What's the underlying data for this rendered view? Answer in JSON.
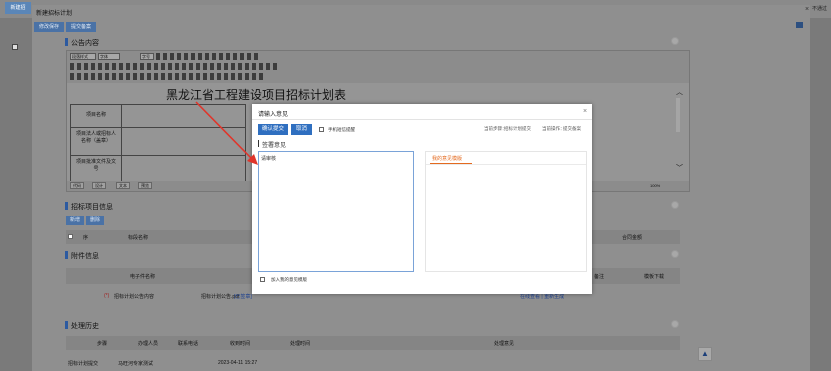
{
  "app": {
    "tab": "新建招",
    "right_text": "不通过"
  },
  "panel": {
    "title": "新建招标计划",
    "close": "×"
  },
  "toolbar": {
    "save": "修改保存",
    "submit": "提交备案"
  },
  "notice": {
    "title": "公告内容",
    "toolbar_style": "段落样式",
    "toolbar_font": "字体",
    "toolbar_size": "字号",
    "doc_title": "黑龙江省工程建设项目招标计划表",
    "rows": [
      "项目名称",
      "项目法人或招标人名称（盖章）",
      "项目批准文件及文号"
    ],
    "tabs": [
      "代码",
      "设计",
      "文本",
      "预览"
    ],
    "zoom": "100%"
  },
  "bid_info": {
    "title": "招标项目信息",
    "add": "新增",
    "delete": "删除",
    "headers": [
      "序",
      "标段名称",
      "合同金额"
    ]
  },
  "attachments": {
    "title": "附件信息",
    "headers": [
      "电子件名称",
      "备注",
      "模板下载"
    ],
    "row": {
      "required": "(*)",
      "name": "招标计划公告内容",
      "file": "招标计划公告.pdf",
      "file_link": "[已签章]",
      "actions": "在线查看 | 重新生成"
    }
  },
  "history": {
    "title": "处理历史",
    "headers": [
      "步骤",
      "办理人员",
      "联系电话",
      "收到时间",
      "处理时间",
      "处理意见"
    ],
    "row": {
      "step": "招标计划提交",
      "person": "马旺河专家测试",
      "received": "2023-04-11 15:27"
    }
  },
  "dialog": {
    "title": "请输入意见",
    "confirm": "确认提交",
    "cancel": "取消",
    "sms": "手机短信提醒",
    "current_step_label": "当前步骤：",
    "current_step": "招标计划提交",
    "current_op_label": "当前操作：",
    "current_op": "提交备案",
    "section": "签署意见",
    "textarea_placeholder": "请审核",
    "add_template": "加入我的意见模版",
    "my_templates_tab": "我的意见模版"
  },
  "colors": {
    "primary": "#2f6fc0",
    "accent_tab": "#e46a1f",
    "arrow": "#e0352b"
  },
  "icons": {
    "close": "close-icon",
    "grid": "grid-icon",
    "up": "arrow-up-icon",
    "collapse": "collapse-circle-icon"
  }
}
